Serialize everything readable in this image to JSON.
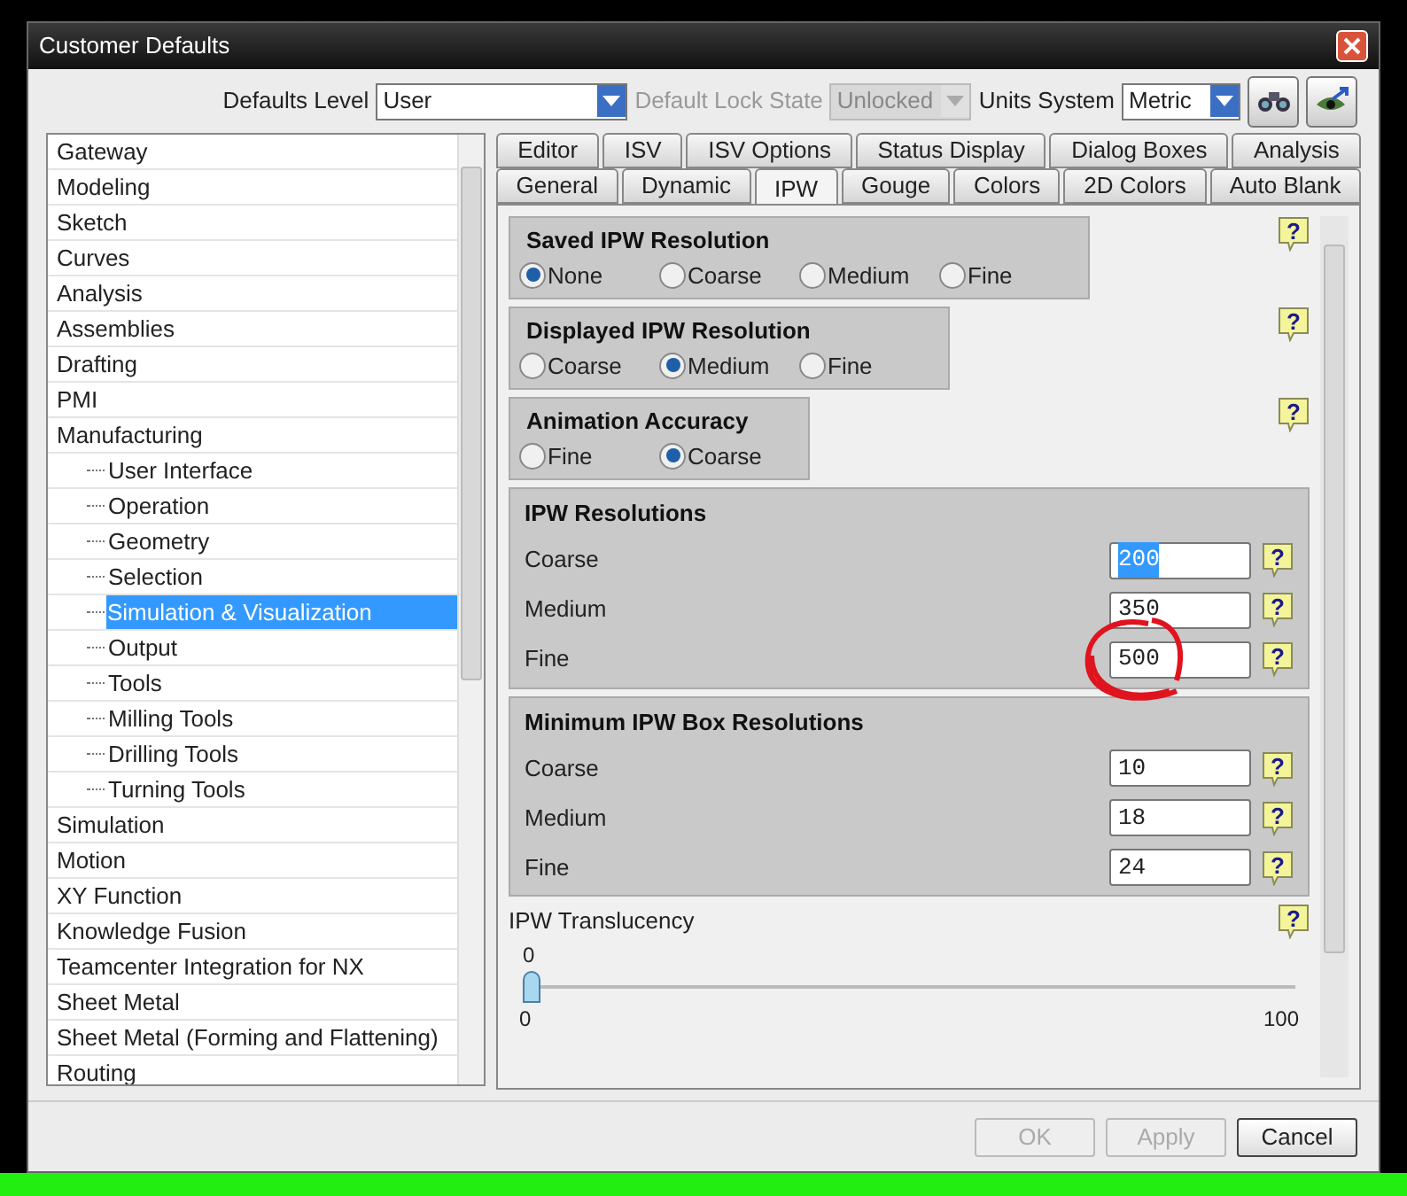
{
  "window": {
    "title": "Customer Defaults"
  },
  "toolbar": {
    "defaults_level": {
      "label": "Defaults Level",
      "value": "User"
    },
    "lock_state": {
      "label": "Default Lock State",
      "value": "Unlocked",
      "disabled": true
    },
    "units": {
      "label": "Units System",
      "value": "Metric"
    }
  },
  "sidebar": {
    "items": [
      {
        "label": "Gateway",
        "selected": false
      },
      {
        "label": "Modeling",
        "selected": false
      },
      {
        "label": "Sketch",
        "selected": false
      },
      {
        "label": "Curves",
        "selected": false
      },
      {
        "label": "Analysis",
        "selected": false
      },
      {
        "label": "Assemblies",
        "selected": false
      },
      {
        "label": "Drafting",
        "selected": false
      },
      {
        "label": "PMI",
        "selected": false
      },
      {
        "label": "Manufacturing",
        "selected": false,
        "children": [
          {
            "label": "User Interface",
            "selected": false
          },
          {
            "label": "Operation",
            "selected": false
          },
          {
            "label": "Geometry",
            "selected": false
          },
          {
            "label": "Selection",
            "selected": false
          },
          {
            "label": "Simulation & Visualization",
            "selected": true
          },
          {
            "label": "Output",
            "selected": false
          },
          {
            "label": "Tools",
            "selected": false
          },
          {
            "label": "Milling Tools",
            "selected": false
          },
          {
            "label": "Drilling Tools",
            "selected": false
          },
          {
            "label": "Turning Tools",
            "selected": false
          }
        ]
      },
      {
        "label": "Simulation",
        "selected": false
      },
      {
        "label": "Motion",
        "selected": false
      },
      {
        "label": "XY Function",
        "selected": false
      },
      {
        "label": "Knowledge Fusion",
        "selected": false
      },
      {
        "label": "Teamcenter Integration for NX",
        "selected": false
      },
      {
        "label": "Sheet Metal",
        "selected": false
      },
      {
        "label": "Sheet Metal (Forming and Flattening)",
        "selected": false
      },
      {
        "label": "Routing",
        "selected": false
      }
    ]
  },
  "tab_rows": [
    [
      {
        "label": "Editor",
        "selected": false
      },
      {
        "label": "ISV",
        "selected": false
      },
      {
        "label": "ISV Options",
        "selected": false
      },
      {
        "label": "Status Display",
        "selected": false
      },
      {
        "label": "Dialog Boxes",
        "selected": false
      },
      {
        "label": "Analysis",
        "selected": false
      }
    ],
    [
      {
        "label": "General",
        "selected": false
      },
      {
        "label": "Dynamic",
        "selected": false
      },
      {
        "label": "IPW",
        "selected": true
      },
      {
        "label": "Gouge",
        "selected": false
      },
      {
        "label": "Colors",
        "selected": false
      },
      {
        "label": "2D Colors",
        "selected": false
      },
      {
        "label": "Auto Blank",
        "selected": false
      }
    ]
  ],
  "radio_groups": [
    {
      "title": "Saved IPW Resolution",
      "help": "?",
      "options": [
        {
          "label": "None",
          "selected": true
        },
        {
          "label": "Coarse",
          "selected": false
        },
        {
          "label": "Medium",
          "selected": false
        },
        {
          "label": "Fine",
          "selected": false
        }
      ]
    },
    {
      "title": "Displayed IPW Resolution",
      "help": "?",
      "options": [
        {
          "label": "Coarse",
          "selected": false
        },
        {
          "label": "Medium",
          "selected": true
        },
        {
          "label": "Fine",
          "selected": false
        }
      ]
    },
    {
      "title": "Animation Accuracy",
      "help": "?",
      "options": [
        {
          "label": "Fine",
          "selected": false
        },
        {
          "label": "Coarse",
          "selected": true
        }
      ]
    }
  ],
  "field_groups": [
    {
      "title": "IPW Resolutions",
      "fields": [
        {
          "label": "Coarse",
          "value": "200",
          "help": "?",
          "highlighted": true,
          "circled": false
        },
        {
          "label": "Medium",
          "value": "350",
          "help": "?",
          "highlighted": false,
          "circled": false
        },
        {
          "label": "Fine",
          "value": "500",
          "help": "?",
          "highlighted": false,
          "circled": true
        }
      ]
    },
    {
      "title": "Minimum IPW Box Resolutions",
      "fields": [
        {
          "label": "Coarse",
          "value": "10",
          "help": "?",
          "highlighted": false,
          "circled": false
        },
        {
          "label": "Medium",
          "value": "18",
          "help": "?",
          "highlighted": false,
          "circled": false
        },
        {
          "label": "Fine",
          "value": "24",
          "help": "?",
          "highlighted": false,
          "circled": false
        }
      ]
    }
  ],
  "translucency": {
    "label": "IPW Translucency",
    "help": "?",
    "value": "0",
    "min": "0",
    "max": "100",
    "level": 0
  },
  "buttons": [
    {
      "label": "OK",
      "disabled": true
    },
    {
      "label": "Apply",
      "disabled": true
    },
    {
      "label": "Cancel",
      "disabled": false
    }
  ]
}
